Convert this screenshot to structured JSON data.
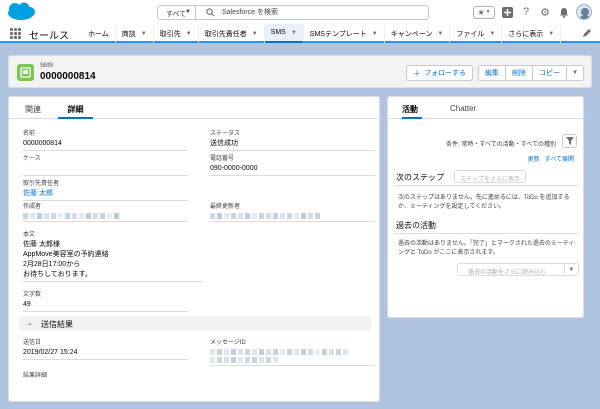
{
  "header": {
    "search_scope": "すべて",
    "search_placeholder": "Salesforce を検索",
    "icons": [
      "favorites-star-icon",
      "add-icon",
      "help-icon",
      "setup-gear-icon",
      "notifications-bell-icon",
      "avatar"
    ]
  },
  "nav": {
    "app_name": "セールス",
    "tabs": [
      {
        "label": "ホーム",
        "dropdown": false
      },
      {
        "label": "商談",
        "dropdown": true
      },
      {
        "label": "取引先",
        "dropdown": true
      },
      {
        "label": "取引先責任者",
        "dropdown": true
      },
      {
        "label": "SMS",
        "dropdown": true,
        "active": true
      },
      {
        "label": "SMSテンプレート",
        "dropdown": true
      },
      {
        "label": "キャンペーン",
        "dropdown": true
      },
      {
        "label": "ファイル",
        "dropdown": true
      },
      {
        "label": "さらに表示",
        "dropdown": true
      }
    ]
  },
  "record": {
    "object_type": "SMS",
    "name": "0000000814",
    "follow_label": "フォローする",
    "edit_label": "編集",
    "delete_label": "削除",
    "copy_label": "コピー"
  },
  "detail": {
    "tabs": {
      "related": "関連",
      "details": "詳細"
    },
    "name_label": "名前",
    "name_value": "0000000814",
    "status_label": "ステータス",
    "status_value": "送信成功",
    "case_label": "ケース",
    "phone_label": "電話番号",
    "phone_value": "090-0000-0000",
    "contact_label": "取引先責任者",
    "contact_value": "佐藤 太郎",
    "created_by_label": "作成者",
    "modified_by_label": "最終更新者",
    "body_label": "本文",
    "body_lines": [
      "佐藤 太郎様",
      "AppMove美容室の予約連絡",
      "2月28日17:00から",
      "お待ちしております。"
    ],
    "char_count_label": "文字数",
    "char_count_value": "49",
    "section_title": "送信結果",
    "sent_date_label": "送信日",
    "sent_date_value": "2019/02/27 15:24",
    "message_id_label": "メッセージID",
    "error_detail_label": "結果詳細"
  },
  "activity": {
    "tabs": {
      "activity": "活動",
      "chatter": "Chatter"
    },
    "filter_text": "条件: 常時・すべての活動・すべての種別",
    "refresh_label": "更新",
    "expand_all_label": "すべて展開",
    "next_steps_title": "次のステップ",
    "more_steps_label": "ステップをさらに表示",
    "next_steps_empty": "次のステップはありません。先に進めるには、ToDo を追加するか、ミーティングを設定してください。",
    "past_title": "過去の活動",
    "past_empty": "過去の活動はありません。「完了」とマークされた過去のミーティングと ToDo がここに表示されます。",
    "load_more_label": "過去の活動をさらに読み込む"
  },
  "colors": {
    "brand": "#0070d2",
    "sms_icon": "#7ac451",
    "page_bg": "#b0c4df"
  }
}
